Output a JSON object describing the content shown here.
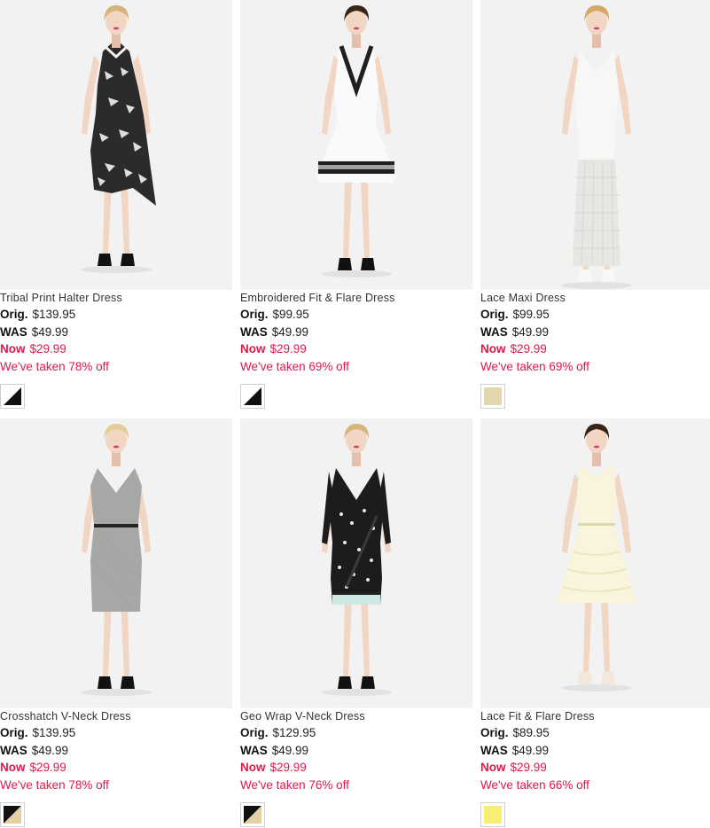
{
  "labels": {
    "orig": "Orig.",
    "was": "WAS",
    "now": "Now"
  },
  "products": [
    {
      "name": "Tribal Print Halter Dress",
      "orig": "$139.95",
      "was": "$49.99",
      "now": "$29.99",
      "discount": "We've taken 78% off",
      "swatch": {
        "type": "split",
        "colors": [
          "#ffffff",
          "#111111"
        ]
      },
      "dress_color": "#2b2b2b",
      "dress_accent": "#f2f2f2",
      "style": "halter-print",
      "hair_color": "#d7b27a"
    },
    {
      "name": "Embroidered Fit & Flare Dress",
      "orig": "$99.95",
      "was": "$49.99",
      "now": "$29.99",
      "discount": "We've taken 69% off",
      "swatch": {
        "type": "split",
        "colors": [
          "#ffffff",
          "#111111"
        ]
      },
      "dress_color": "#fafafa",
      "dress_accent": "#1f1f1f",
      "style": "fit-flare-embroidered",
      "hair_color": "#3a2418"
    },
    {
      "name": "Lace Maxi Dress",
      "orig": "$99.95",
      "was": "$49.99",
      "now": "$29.99",
      "discount": "We've taken 69% off",
      "swatch": {
        "type": "solid",
        "colors": [
          "#e1d6ac"
        ]
      },
      "dress_color": "#f7f7f5",
      "dress_accent": "#e6e6e2",
      "style": "maxi-lace",
      "hair_color": "#d4a864"
    },
    {
      "name": "Crosshatch V-Neck Dress",
      "orig": "$139.95",
      "was": "$49.99",
      "now": "$29.99",
      "discount": "We've taken 78% off",
      "swatch": {
        "type": "split",
        "colors": [
          "#111111",
          "#e3cfa4"
        ]
      },
      "dress_color": "#a7a7a5",
      "dress_accent": "#232323",
      "style": "sheath",
      "hair_color": "#e4cc96"
    },
    {
      "name": "Geo Wrap V-Neck Dress",
      "orig": "$129.95",
      "was": "$49.99",
      "now": "$29.99",
      "discount": "We've taken 76% off",
      "swatch": {
        "type": "split",
        "colors": [
          "#111111",
          "#e3cfa4"
        ]
      },
      "dress_color": "#1c1c1c",
      "dress_accent": "#cfe8e4",
      "style": "wrap-geo",
      "hair_color": "#d6b57c"
    },
    {
      "name": "Lace Fit & Flare Dress",
      "orig": "$89.95",
      "was": "$49.99",
      "now": "$29.99",
      "discount": "We've taken 66% off",
      "swatch": {
        "type": "solid",
        "colors": [
          "#f7ee72"
        ]
      },
      "dress_color": "#f8f5dc",
      "dress_accent": "#ece6c4",
      "style": "lace-flare",
      "hair_color": "#3a2416"
    }
  ]
}
